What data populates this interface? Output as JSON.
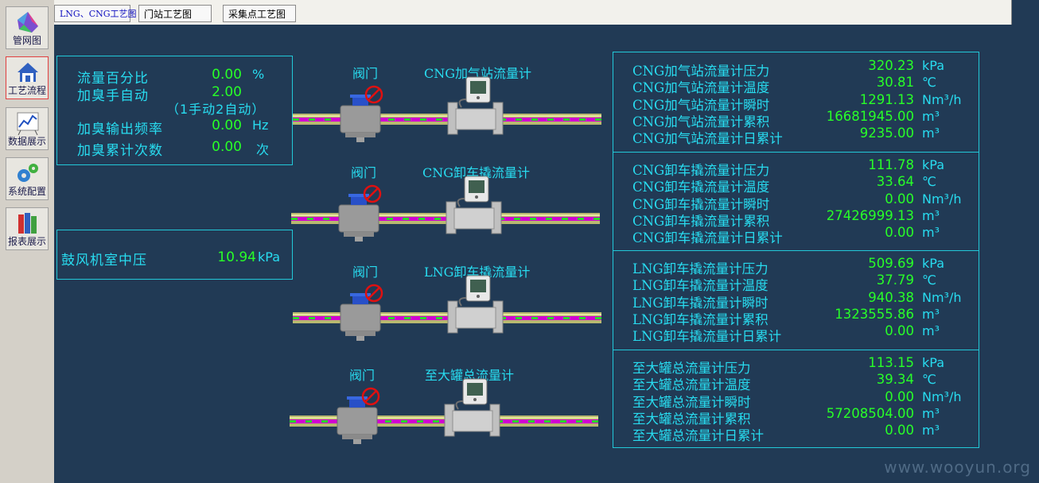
{
  "sidebar": {
    "items": [
      {
        "label": "管网图",
        "icon": "network-map-icon"
      },
      {
        "label": "工艺流程",
        "icon": "house-icon"
      },
      {
        "label": "数据展示",
        "icon": "chart-icon"
      },
      {
        "label": "系统配置",
        "icon": "gears-icon"
      },
      {
        "label": "报表展示",
        "icon": "books-icon"
      }
    ]
  },
  "tabs": [
    "LNG、CNG工艺图",
    "门站工艺图",
    "采集点工艺图"
  ],
  "odor_panel": {
    "rows": [
      {
        "label": "流量百分比",
        "value": "0.00",
        "unit": "%"
      },
      {
        "label": "加臭手自动",
        "value": "2.00",
        "unit": ""
      },
      {
        "label": "加臭输出频率",
        "value": "0.00",
        "unit": "Hz"
      },
      {
        "label": "加臭累计次数",
        "value": "0.00",
        "unit": "次"
      }
    ],
    "note": "（1手动2自动）"
  },
  "blower_panel": {
    "label": "鼓风机室中压",
    "value": "10.94",
    "unit": "kPa"
  },
  "pipelines": [
    {
      "valve_label": "阀门",
      "meter_label": "CNG加气站流量计"
    },
    {
      "valve_label": "阀门",
      "meter_label": "CNG卸车撬流量计"
    },
    {
      "valve_label": "阀门",
      "meter_label": "LNG卸车撬流量计"
    },
    {
      "valve_label": "阀门",
      "meter_label": "至大罐总流量计"
    }
  ],
  "meter_groups": [
    {
      "rows": [
        {
          "label": "CNG加气站流量计压力",
          "value": "320.23",
          "unit": "kPa"
        },
        {
          "label": "CNG加气站流量计温度",
          "value": "30.81",
          "unit": "℃"
        },
        {
          "label": "CNG加气站流量计瞬时",
          "value": "1291.13",
          "unit": "Nm³/h"
        },
        {
          "label": "CNG加气站流量计累积",
          "value": "16681945.00",
          "unit": "m³"
        },
        {
          "label": "CNG加气站流量计日累计",
          "value": "9235.00",
          "unit": "m³"
        }
      ]
    },
    {
      "rows": [
        {
          "label": "CNG卸车撬流量计压力",
          "value": "111.78",
          "unit": "kPa"
        },
        {
          "label": "CNG卸车撬流量计温度",
          "value": "33.64",
          "unit": "℃"
        },
        {
          "label": "CNG卸车撬流量计瞬时",
          "value": "0.00",
          "unit": "Nm³/h"
        },
        {
          "label": "CNG卸车撬流量计累积",
          "value": "27426999.13",
          "unit": "m³"
        },
        {
          "label": "CNG卸车撬流量计日累计",
          "value": "0.00",
          "unit": "m³"
        }
      ]
    },
    {
      "rows": [
        {
          "label": "LNG卸车撬流量计压力",
          "value": "509.69",
          "unit": "kPa"
        },
        {
          "label": "LNG卸车撬流量计温度",
          "value": "37.79",
          "unit": "℃"
        },
        {
          "label": "LNG卸车撬流量计瞬时",
          "value": "940.38",
          "unit": "Nm³/h"
        },
        {
          "label": "LNG卸车撬流量计累积",
          "value": "1323555.86",
          "unit": "m³"
        },
        {
          "label": "LNG卸车撬流量计日累计",
          "value": "0.00",
          "unit": "m³"
        }
      ]
    },
    {
      "rows": [
        {
          "label": "至大罐总流量计压力",
          "value": "113.15",
          "unit": "kPa"
        },
        {
          "label": "至大罐总流量计温度",
          "value": "39.34",
          "unit": "℃"
        },
        {
          "label": "至大罐总流量计瞬时",
          "value": "0.00",
          "unit": "Nm³/h"
        },
        {
          "label": "至大罐总流量计累积",
          "value": "57208504.00",
          "unit": "m³"
        },
        {
          "label": "至大罐总流量计日累计",
          "value": "0.00",
          "unit": "m³"
        }
      ]
    }
  ],
  "watermark": "www.wooyun.org",
  "colors": {
    "background": "#213a55",
    "label": "#28dcf0",
    "value": "#28ff28",
    "pipe_flow": "#d000d0",
    "valve_alarm": "#e01010"
  }
}
